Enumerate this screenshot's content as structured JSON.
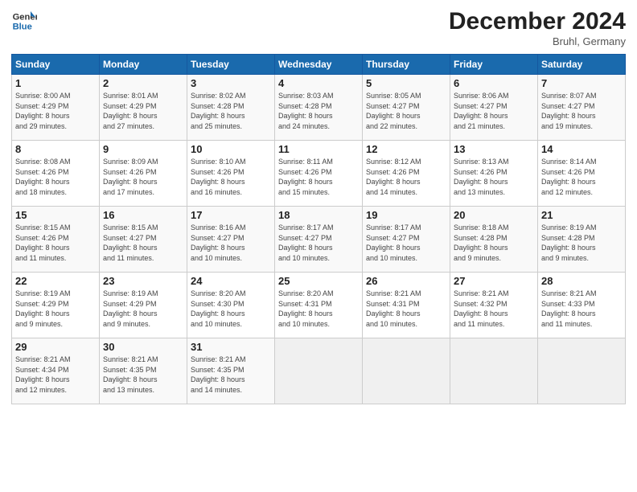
{
  "header": {
    "logo_general": "General",
    "logo_blue": "Blue",
    "month_title": "December 2024",
    "subtitle": "Bruhl, Germany"
  },
  "days_of_week": [
    "Sunday",
    "Monday",
    "Tuesday",
    "Wednesday",
    "Thursday",
    "Friday",
    "Saturday"
  ],
  "weeks": [
    [
      {
        "day": "1",
        "info": "Sunrise: 8:00 AM\nSunset: 4:29 PM\nDaylight: 8 hours\nand 29 minutes."
      },
      {
        "day": "2",
        "info": "Sunrise: 8:01 AM\nSunset: 4:29 PM\nDaylight: 8 hours\nand 27 minutes."
      },
      {
        "day": "3",
        "info": "Sunrise: 8:02 AM\nSunset: 4:28 PM\nDaylight: 8 hours\nand 25 minutes."
      },
      {
        "day": "4",
        "info": "Sunrise: 8:03 AM\nSunset: 4:28 PM\nDaylight: 8 hours\nand 24 minutes."
      },
      {
        "day": "5",
        "info": "Sunrise: 8:05 AM\nSunset: 4:27 PM\nDaylight: 8 hours\nand 22 minutes."
      },
      {
        "day": "6",
        "info": "Sunrise: 8:06 AM\nSunset: 4:27 PM\nDaylight: 8 hours\nand 21 minutes."
      },
      {
        "day": "7",
        "info": "Sunrise: 8:07 AM\nSunset: 4:27 PM\nDaylight: 8 hours\nand 19 minutes."
      }
    ],
    [
      {
        "day": "8",
        "info": "Sunrise: 8:08 AM\nSunset: 4:26 PM\nDaylight: 8 hours\nand 18 minutes."
      },
      {
        "day": "9",
        "info": "Sunrise: 8:09 AM\nSunset: 4:26 PM\nDaylight: 8 hours\nand 17 minutes."
      },
      {
        "day": "10",
        "info": "Sunrise: 8:10 AM\nSunset: 4:26 PM\nDaylight: 8 hours\nand 16 minutes."
      },
      {
        "day": "11",
        "info": "Sunrise: 8:11 AM\nSunset: 4:26 PM\nDaylight: 8 hours\nand 15 minutes."
      },
      {
        "day": "12",
        "info": "Sunrise: 8:12 AM\nSunset: 4:26 PM\nDaylight: 8 hours\nand 14 minutes."
      },
      {
        "day": "13",
        "info": "Sunrise: 8:13 AM\nSunset: 4:26 PM\nDaylight: 8 hours\nand 13 minutes."
      },
      {
        "day": "14",
        "info": "Sunrise: 8:14 AM\nSunset: 4:26 PM\nDaylight: 8 hours\nand 12 minutes."
      }
    ],
    [
      {
        "day": "15",
        "info": "Sunrise: 8:15 AM\nSunset: 4:26 PM\nDaylight: 8 hours\nand 11 minutes."
      },
      {
        "day": "16",
        "info": "Sunrise: 8:15 AM\nSunset: 4:27 PM\nDaylight: 8 hours\nand 11 minutes."
      },
      {
        "day": "17",
        "info": "Sunrise: 8:16 AM\nSunset: 4:27 PM\nDaylight: 8 hours\nand 10 minutes."
      },
      {
        "day": "18",
        "info": "Sunrise: 8:17 AM\nSunset: 4:27 PM\nDaylight: 8 hours\nand 10 minutes."
      },
      {
        "day": "19",
        "info": "Sunrise: 8:17 AM\nSunset: 4:27 PM\nDaylight: 8 hours\nand 10 minutes."
      },
      {
        "day": "20",
        "info": "Sunrise: 8:18 AM\nSunset: 4:28 PM\nDaylight: 8 hours\nand 9 minutes."
      },
      {
        "day": "21",
        "info": "Sunrise: 8:19 AM\nSunset: 4:28 PM\nDaylight: 8 hours\nand 9 minutes."
      }
    ],
    [
      {
        "day": "22",
        "info": "Sunrise: 8:19 AM\nSunset: 4:29 PM\nDaylight: 8 hours\nand 9 minutes."
      },
      {
        "day": "23",
        "info": "Sunrise: 8:19 AM\nSunset: 4:29 PM\nDaylight: 8 hours\nand 9 minutes."
      },
      {
        "day": "24",
        "info": "Sunrise: 8:20 AM\nSunset: 4:30 PM\nDaylight: 8 hours\nand 10 minutes."
      },
      {
        "day": "25",
        "info": "Sunrise: 8:20 AM\nSunset: 4:31 PM\nDaylight: 8 hours\nand 10 minutes."
      },
      {
        "day": "26",
        "info": "Sunrise: 8:21 AM\nSunset: 4:31 PM\nDaylight: 8 hours\nand 10 minutes."
      },
      {
        "day": "27",
        "info": "Sunrise: 8:21 AM\nSunset: 4:32 PM\nDaylight: 8 hours\nand 11 minutes."
      },
      {
        "day": "28",
        "info": "Sunrise: 8:21 AM\nSunset: 4:33 PM\nDaylight: 8 hours\nand 11 minutes."
      }
    ],
    [
      {
        "day": "29",
        "info": "Sunrise: 8:21 AM\nSunset: 4:34 PM\nDaylight: 8 hours\nand 12 minutes."
      },
      {
        "day": "30",
        "info": "Sunrise: 8:21 AM\nSunset: 4:35 PM\nDaylight: 8 hours\nand 13 minutes."
      },
      {
        "day": "31",
        "info": "Sunrise: 8:21 AM\nSunset: 4:35 PM\nDaylight: 8 hours\nand 14 minutes."
      },
      {
        "day": "",
        "info": ""
      },
      {
        "day": "",
        "info": ""
      },
      {
        "day": "",
        "info": ""
      },
      {
        "day": "",
        "info": ""
      }
    ]
  ]
}
